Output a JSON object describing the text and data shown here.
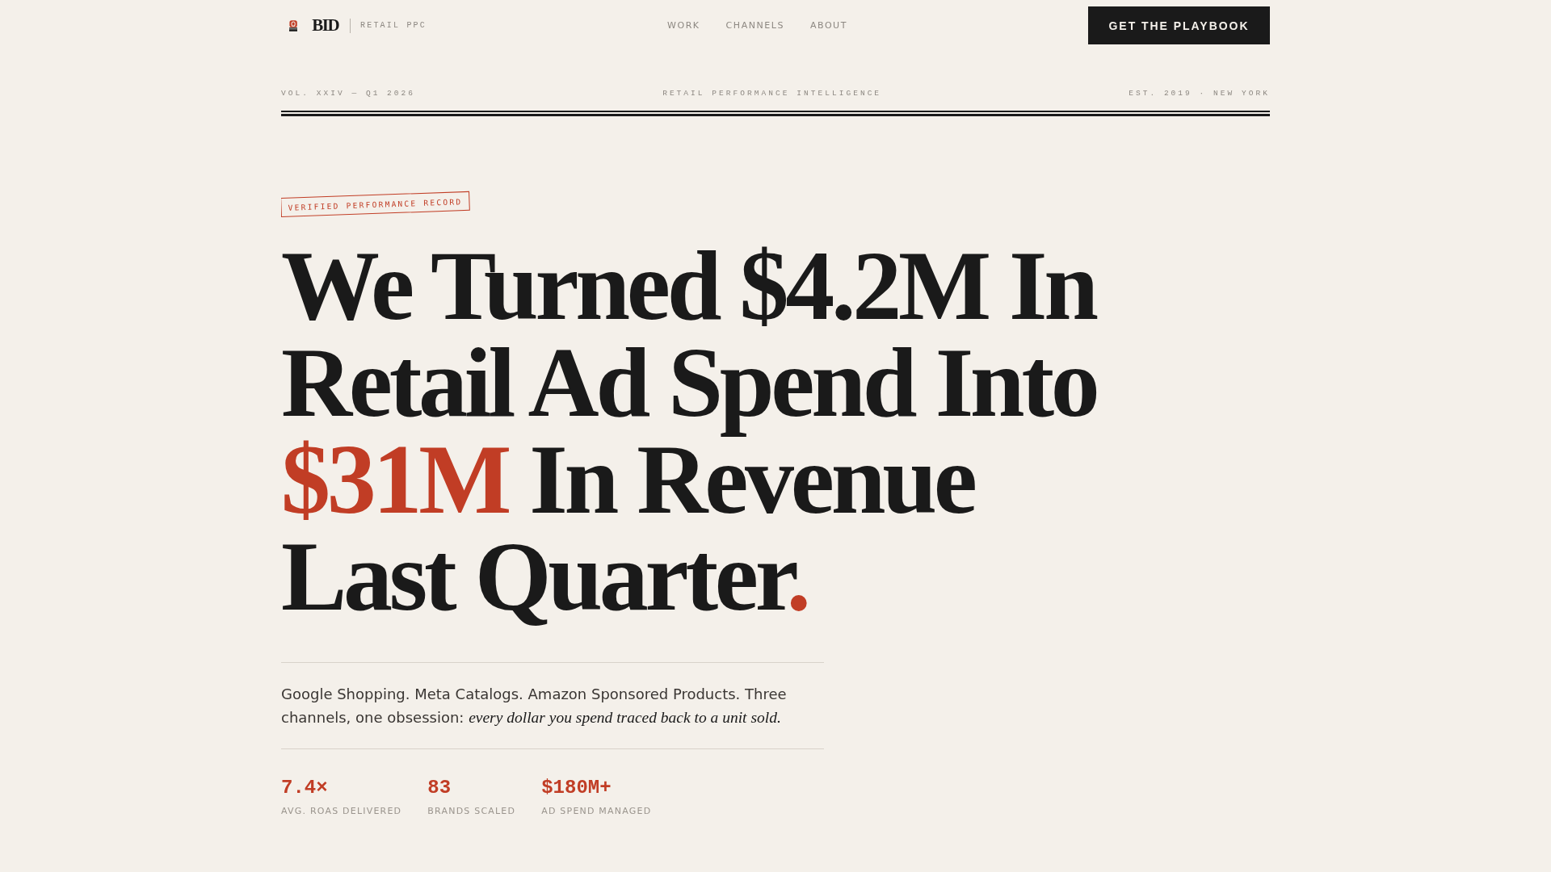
{
  "nav": {
    "brand": "BID",
    "tagline": "RETAIL PPC",
    "links": [
      {
        "label": "WORK"
      },
      {
        "label": "CHANNELS"
      },
      {
        "label": "ABOUT"
      }
    ],
    "cta": "GET THE PLAYBOOK"
  },
  "masthead": {
    "left": "VOL. XXIV — Q1 2026",
    "center": "RETAIL PERFORMANCE INTELLIGENCE",
    "right": "EST. 2019 · NEW YORK"
  },
  "hero": {
    "badge": "VERIFIED PERFORMANCE RECORD",
    "headline": [
      [
        {
          "text": "We Turned $4.2M In",
          "accent": false
        }
      ],
      [
        {
          "text": "Retail Ad Spend Into",
          "accent": false
        }
      ],
      [
        {
          "text": "$31M",
          "accent": true
        },
        {
          "text": " In Revenue",
          "accent": false
        }
      ],
      [
        {
          "text": "Last Quarter",
          "accent": false
        },
        {
          "text": ".",
          "accent": true
        }
      ]
    ],
    "lede": "Google Shopping. Meta Catalogs. Amazon Sponsored Products. Three channels, one obsession: *every dollar you spend traced back to a unit sold.*",
    "stats": [
      {
        "value": "7.4×",
        "label": "AVG. ROAS DELIVERED"
      },
      {
        "value": "83",
        "label": "BRANDS SCALED"
      },
      {
        "value": "$180M+",
        "label": "AD SPEND MANAGED"
      }
    ]
  }
}
